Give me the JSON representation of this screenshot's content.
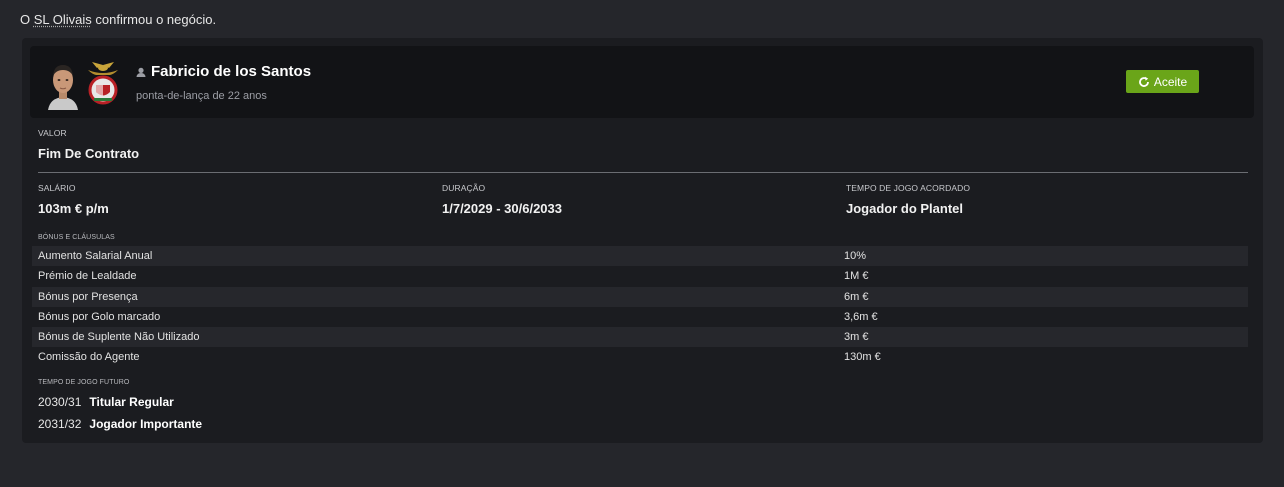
{
  "notice": {
    "prefix": "O ",
    "club": "SL Olivais",
    "suffix": " confirmou o negócio."
  },
  "player": {
    "name": "Fabricio de los Santos",
    "description": "ponta-de-lança de 22 anos",
    "face_icon": "player-face-icon",
    "crest_icon": "club-crest-icon"
  },
  "status": {
    "label": "Aceite",
    "icon": "refresh-icon",
    "color": "#6aa519"
  },
  "contract": {
    "value_label": "VALOR",
    "value": "Fim De Contrato",
    "salary_label": "SALÁRIO",
    "salary": "103m € p/m",
    "duration_label": "DURAÇÃO",
    "duration": "1/7/2029 - 30/6/2033",
    "playing_time_label": "TEMPO DE JOGO ACORDADO",
    "playing_time": "Jogador do Plantel"
  },
  "bonuses": {
    "title": "BÓNUS E CLÁUSULAS",
    "rows": [
      {
        "label": "Aumento Salarial Anual",
        "value": "10%"
      },
      {
        "label": "Prémio de Lealdade",
        "value": "1M €"
      },
      {
        "label": "Bónus por Presença",
        "value": "6m €"
      },
      {
        "label": "Bónus por Golo marcado",
        "value": "3,6m €"
      },
      {
        "label": "Bónus de Suplente Não Utilizado",
        "value": "3m €"
      },
      {
        "label": "Comissão do Agente",
        "value": "130m €"
      }
    ]
  },
  "future": {
    "title": "TEMPO DE JOGO FUTURO",
    "rows": [
      {
        "season": "2030/31",
        "role": "Titular Regular"
      },
      {
        "season": "2031/32",
        "role": "Jogador Importante"
      }
    ]
  }
}
